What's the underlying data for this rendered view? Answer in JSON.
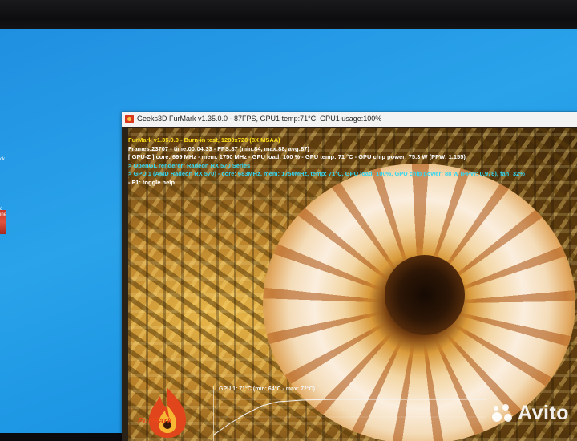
{
  "desktop": {
    "icon_label_top": "ck",
    "icon_label_bottom_1": "d",
    "icon_label_bottom_2": "ine"
  },
  "window": {
    "title": "Geeks3D FurMark v1.35.0.0 - 87FPS, GPU1 temp:71°C, GPU1 usage:100%",
    "app_icon": "furmark-flame-icon"
  },
  "osd": {
    "line1": "FurMark v1.35.0.0 - Burn-in test, 1280x720 (8X MSAA)",
    "line2": "Frames:23707 - time:00:04:33 - FPS:87 (min:84, max:88, avg:87)",
    "line3": "[ GPU-Z ] core: 699 MHz - mem: 1750 MHz - GPU load: 100 % - GPU temp: 71 °C - GPU chip power: 75.3 W (PPW: 1.155)",
    "line4": "> OpenGL renderer: Radeon RX 570 Series",
    "line5": "> GPU 1 (AMD Radeon RX 570) - core: 683MHz, mem: 1750MHz, temp: 71°C, GPU load: 100%, GPU chip power: 88 W (PPW: 0.978), fan: 32%",
    "line6": "- F1: toggle help"
  },
  "graph": {
    "label": "GPU 1: 71°C (min: 64°C - max: 72°C)"
  },
  "logo": {
    "text": "FurMark"
  },
  "watermark": {
    "text": "Avito"
  },
  "colors": {
    "desktop_blue": "#2aa3ea",
    "osd_yellow": "#ffe21a",
    "osd_cyan": "#35d6f0",
    "furmark_red": "#d8381e"
  }
}
